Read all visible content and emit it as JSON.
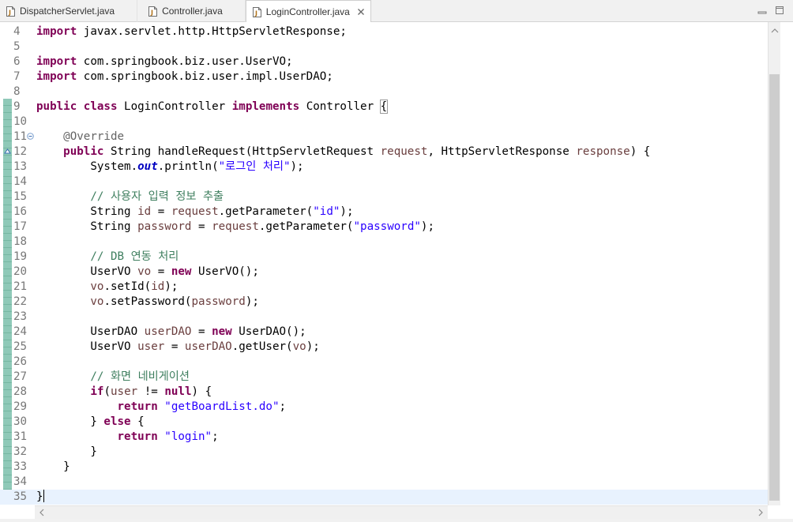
{
  "tabs": [
    {
      "label": "DispatcherServlet.java",
      "active": false
    },
    {
      "label": "Controller.java",
      "active": false
    },
    {
      "label": "LoginController.java",
      "active": true
    }
  ],
  "icons": {
    "file": "java-file-icon",
    "close": "close-icon",
    "minimize": "minimize-icon",
    "maximize": "maximize-icon",
    "fold": "fold-collapse-icon",
    "override": "override-marker-icon"
  },
  "colors": {
    "keyword": "#7f0055",
    "string": "#2a00ff",
    "comment": "#3f7f5f",
    "annotation": "#646464",
    "local_var": "#6a3e3e",
    "field": "#0000c0",
    "current_line": "#e8f2fe",
    "change_bar": "#8fc9b8"
  },
  "lines": [
    {
      "n": "4",
      "tokens": [
        {
          "t": "import",
          "c": "kw"
        },
        {
          "t": " javax.servlet.http.HttpServletResponse;"
        }
      ]
    },
    {
      "n": "5",
      "tokens": []
    },
    {
      "n": "6",
      "tokens": [
        {
          "t": "import",
          "c": "kw"
        },
        {
          "t": " com.springbook.biz.user.UserVO;"
        }
      ]
    },
    {
      "n": "7",
      "tokens": [
        {
          "t": "import",
          "c": "kw"
        },
        {
          "t": " com.springbook.biz.user.impl.UserDAO;"
        }
      ]
    },
    {
      "n": "8",
      "tokens": []
    },
    {
      "n": "9",
      "tokens": [
        {
          "t": "public",
          "c": "kw"
        },
        {
          "t": " "
        },
        {
          "t": "class",
          "c": "kw"
        },
        {
          "t": " LoginController "
        },
        {
          "t": "implements",
          "c": "kw"
        },
        {
          "t": " Controller "
        },
        {
          "t": "{",
          "c": "bracket"
        }
      ]
    },
    {
      "n": "10",
      "tokens": []
    },
    {
      "n": "11",
      "fold": true,
      "tokens": [
        {
          "t": "    "
        },
        {
          "t": "@Override",
          "c": "ann"
        }
      ]
    },
    {
      "n": "12",
      "override": true,
      "tokens": [
        {
          "t": "    "
        },
        {
          "t": "public",
          "c": "kw"
        },
        {
          "t": " String handleRequest(HttpServletRequest "
        },
        {
          "t": "request",
          "c": "var"
        },
        {
          "t": ", HttpServletResponse "
        },
        {
          "t": "response",
          "c": "var"
        },
        {
          "t": ") {"
        }
      ]
    },
    {
      "n": "13",
      "tokens": [
        {
          "t": "        System."
        },
        {
          "t": "out",
          "c": "fld"
        },
        {
          "t": ".println("
        },
        {
          "t": "\"로그인 처리\"",
          "c": "str"
        },
        {
          "t": ");"
        }
      ]
    },
    {
      "n": "14",
      "tokens": []
    },
    {
      "n": "15",
      "tokens": [
        {
          "t": "        "
        },
        {
          "t": "// 사용자 입력 정보 추출",
          "c": "cm"
        }
      ]
    },
    {
      "n": "16",
      "tokens": [
        {
          "t": "        String "
        },
        {
          "t": "id",
          "c": "var"
        },
        {
          "t": " = "
        },
        {
          "t": "request",
          "c": "var"
        },
        {
          "t": ".getParameter("
        },
        {
          "t": "\"id\"",
          "c": "str"
        },
        {
          "t": ");"
        }
      ]
    },
    {
      "n": "17",
      "tokens": [
        {
          "t": "        String "
        },
        {
          "t": "password",
          "c": "var"
        },
        {
          "t": " = "
        },
        {
          "t": "request",
          "c": "var"
        },
        {
          "t": ".getParameter("
        },
        {
          "t": "\"password\"",
          "c": "str"
        },
        {
          "t": ");"
        }
      ]
    },
    {
      "n": "18",
      "tokens": []
    },
    {
      "n": "19",
      "tokens": [
        {
          "t": "        "
        },
        {
          "t": "// DB 연동 처리",
          "c": "cm"
        }
      ]
    },
    {
      "n": "20",
      "tokens": [
        {
          "t": "        UserVO "
        },
        {
          "t": "vo",
          "c": "var"
        },
        {
          "t": " = "
        },
        {
          "t": "new",
          "c": "kw"
        },
        {
          "t": " UserVO();"
        }
      ]
    },
    {
      "n": "21",
      "tokens": [
        {
          "t": "        "
        },
        {
          "t": "vo",
          "c": "var"
        },
        {
          "t": ".setId("
        },
        {
          "t": "id",
          "c": "var"
        },
        {
          "t": ");"
        }
      ]
    },
    {
      "n": "22",
      "tokens": [
        {
          "t": "        "
        },
        {
          "t": "vo",
          "c": "var"
        },
        {
          "t": ".setPassword("
        },
        {
          "t": "password",
          "c": "var"
        },
        {
          "t": ");"
        }
      ]
    },
    {
      "n": "23",
      "tokens": []
    },
    {
      "n": "24",
      "tokens": [
        {
          "t": "        UserDAO "
        },
        {
          "t": "userDAO",
          "c": "var"
        },
        {
          "t": " = "
        },
        {
          "t": "new",
          "c": "kw"
        },
        {
          "t": " UserDAO();"
        }
      ]
    },
    {
      "n": "25",
      "tokens": [
        {
          "t": "        UserVO "
        },
        {
          "t": "user",
          "c": "var"
        },
        {
          "t": " = "
        },
        {
          "t": "userDAO",
          "c": "var"
        },
        {
          "t": ".getUser("
        },
        {
          "t": "vo",
          "c": "var"
        },
        {
          "t": ");"
        }
      ]
    },
    {
      "n": "26",
      "tokens": []
    },
    {
      "n": "27",
      "tokens": [
        {
          "t": "        "
        },
        {
          "t": "// 화면 네비게이션",
          "c": "cm"
        }
      ]
    },
    {
      "n": "28",
      "tokens": [
        {
          "t": "        "
        },
        {
          "t": "if",
          "c": "kw"
        },
        {
          "t": "("
        },
        {
          "t": "user",
          "c": "var"
        },
        {
          "t": " != "
        },
        {
          "t": "null",
          "c": "kw"
        },
        {
          "t": ") {"
        }
      ]
    },
    {
      "n": "29",
      "tokens": [
        {
          "t": "            "
        },
        {
          "t": "return",
          "c": "kw"
        },
        {
          "t": " "
        },
        {
          "t": "\"getBoardList.do\"",
          "c": "str"
        },
        {
          "t": ";"
        }
      ]
    },
    {
      "n": "30",
      "tokens": [
        {
          "t": "        } "
        },
        {
          "t": "else",
          "c": "kw"
        },
        {
          "t": " {"
        }
      ]
    },
    {
      "n": "31",
      "tokens": [
        {
          "t": "            "
        },
        {
          "t": "return",
          "c": "kw"
        },
        {
          "t": " "
        },
        {
          "t": "\"login\"",
          "c": "str"
        },
        {
          "t": ";"
        }
      ]
    },
    {
      "n": "32",
      "tokens": [
        {
          "t": "        }"
        }
      ]
    },
    {
      "n": "33",
      "tokens": [
        {
          "t": "    }"
        }
      ]
    },
    {
      "n": "34",
      "tokens": []
    },
    {
      "n": "35",
      "current": true,
      "caret": true,
      "tokens": [
        {
          "t": "}"
        }
      ]
    }
  ]
}
